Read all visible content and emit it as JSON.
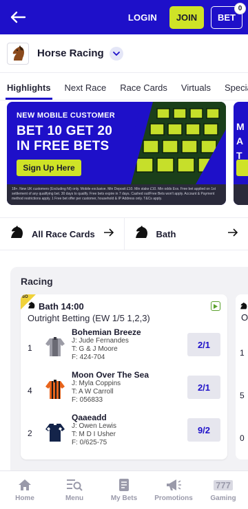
{
  "header": {
    "login_label": "LOGIN",
    "join_label": "JOIN",
    "bet_label": "BET",
    "bet_count": "0"
  },
  "sport": {
    "title": "Horse Racing"
  },
  "tabs": [
    {
      "label": "Highlights"
    },
    {
      "label": "Next Race"
    },
    {
      "label": "Race Cards"
    },
    {
      "label": "Virtuals"
    },
    {
      "label": "Specials"
    }
  ],
  "promo": {
    "kicker": "NEW MOBILE CUSTOMER",
    "line1": "BET 10 GET 20",
    "line2": "IN FREE BETS",
    "cta": "Sign Up Here",
    "terms": "18+. New UK customers (Excluding NI) only. Mobile exclusive. Min Deposit £10. Min stake £10. Min odds Evs. Free bet applied on 1st settlement of any qualifying bet. 30 days to qualify. Free bets expire in 7 days. Cashed out/Free Bets won't apply. Account & Payment method restrictions apply. 1 Free bet offer per customer, household & IP Address only. T&Cs apply.",
    "peek_letters": "M\nA\nT"
  },
  "quick_links": [
    {
      "label": "All Race Cards"
    },
    {
      "label": "Bath"
    }
  ],
  "racing": {
    "section_title": "Racing",
    "badge": "SO",
    "race_title": "Bath 14:00",
    "race_sub": "Outright Betting (EW 1/5 1,2,3)",
    "peek_sub": "O",
    "runners": [
      {
        "num": "1",
        "name": "Bohemian Breeze",
        "jockey": "J: Jude Fernandes",
        "trainer": "T: G & J Moore",
        "form": "F: 424-704",
        "odds": "2/1",
        "silk": "grey"
      },
      {
        "num": "4",
        "name": "Moon Over The Sea",
        "jockey": "J: Myla Coppins",
        "trainer": "T: A W Carroll",
        "form": "F: 056833",
        "odds": "2/1",
        "silk": "orange"
      },
      {
        "num": "2",
        "name": "Qaaeadd",
        "jockey": "J: Owen Lewis",
        "trainer": "T: M D I Usher",
        "form": "F: 0/625-75",
        "odds": "9/2",
        "silk": "navy"
      }
    ],
    "peek_nums": [
      "1",
      "5",
      "0"
    ]
  },
  "bottom_nav": [
    {
      "label": "Home",
      "icon": "home-icon"
    },
    {
      "label": "Menu",
      "icon": "menu-search-icon"
    },
    {
      "label": "My Bets",
      "icon": "bet-slip-icon"
    },
    {
      "label": "Promotions",
      "icon": "megaphone-icon"
    },
    {
      "label": "Gaming",
      "icon": "slot-777-icon",
      "glyph": "777"
    }
  ],
  "colors": {
    "brand": "#1e10c9",
    "accent": "#cfe327"
  }
}
